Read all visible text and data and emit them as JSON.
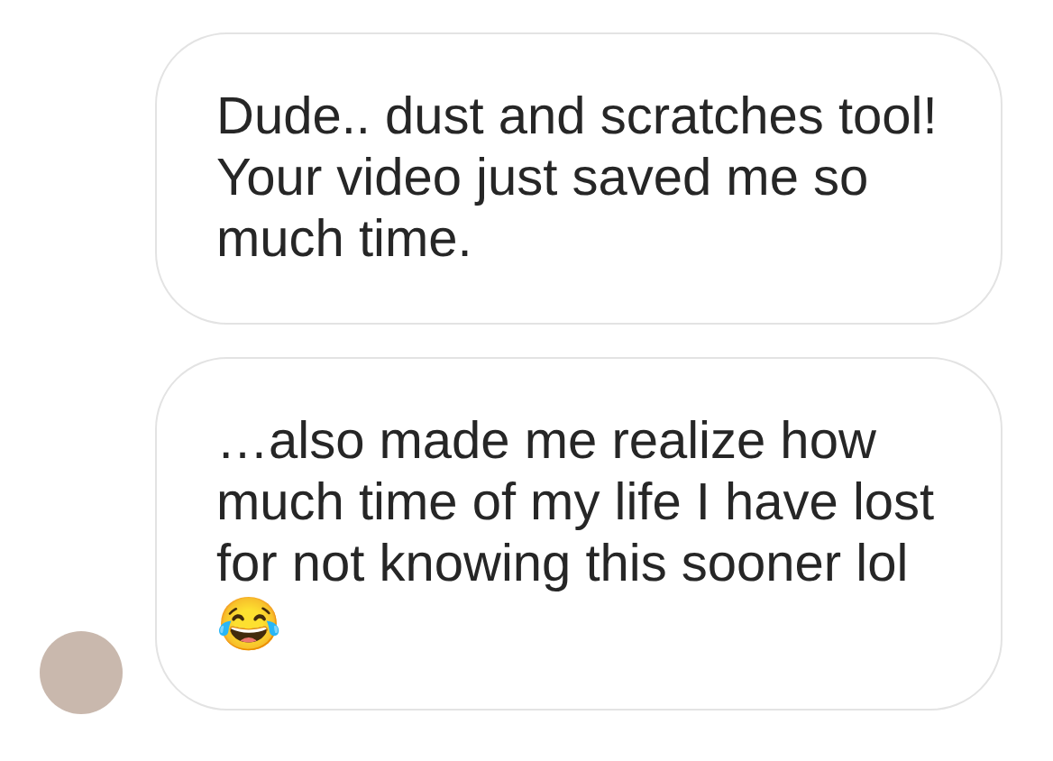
{
  "messages": [
    {
      "text": "Dude.. dust and scratches tool! Your video just saved me so much time.",
      "avatar": false
    },
    {
      "text": "…also made me realize how much time of my life I have lost for not knowing this sooner lol 😂",
      "avatar": true
    }
  ]
}
